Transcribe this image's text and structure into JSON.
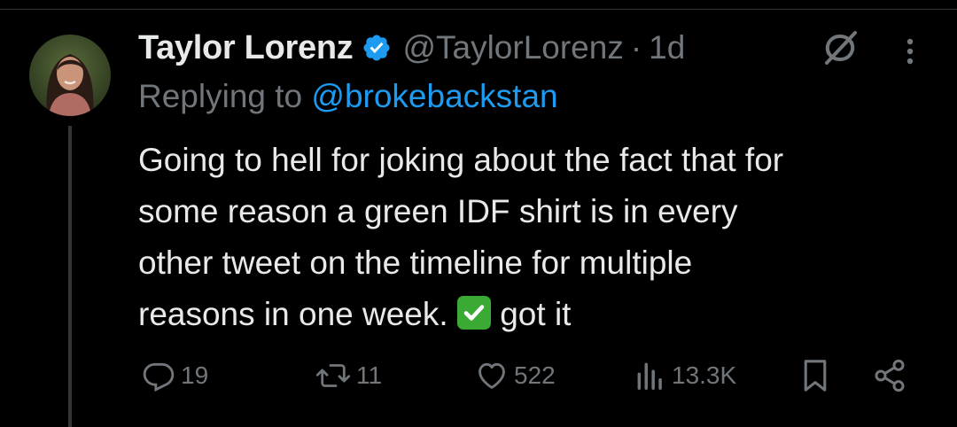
{
  "tweet": {
    "author_name": "Taylor Lorenz",
    "handle": "@TaylorLorenz",
    "separator": "·",
    "time": "1d",
    "reply_prefix": "Replying to",
    "reply_to": "@brokebackstan",
    "text_lines": [
      "Going to hell for joking about the fact that for",
      "some reason a green IDF shirt is in every",
      "other tweet on the timeline for multiple",
      "reasons in one week."
    ],
    "text_tail": "got it",
    "emoji": "white-heavy-check-mark"
  },
  "actions": {
    "replies": "19",
    "reposts": "11",
    "likes": "522",
    "views": "13.3K"
  },
  "icons": {
    "verified": "verified-badge-icon",
    "grok": "grok-icon",
    "more": "more-vertical-icon",
    "reply": "reply-icon",
    "repost": "repost-icon",
    "like": "heart-icon",
    "views": "views-chart-icon",
    "bookmark": "bookmark-icon",
    "share": "share-icon"
  },
  "colors": {
    "background": "#000000",
    "text": "#e7e9ea",
    "muted": "#71767b",
    "link": "#1d9bf0",
    "thread_line": "#333639"
  }
}
